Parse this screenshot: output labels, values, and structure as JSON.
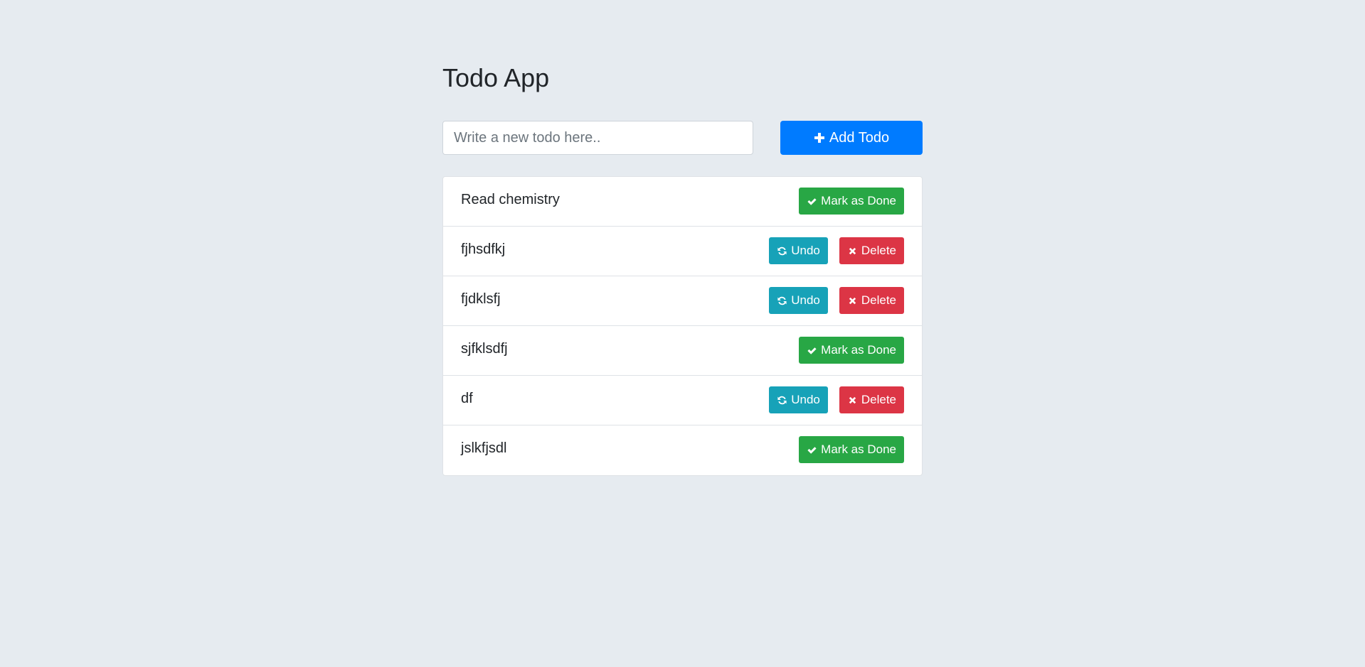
{
  "app": {
    "title": "Todo App"
  },
  "form": {
    "placeholder": "Write a new todo here..",
    "value": "",
    "add_label": "Add Todo",
    "add_icon": "plus-icon"
  },
  "buttons": {
    "done_label": "Mark as Done",
    "undo_label": "Undo",
    "delete_label": "Delete"
  },
  "colors": {
    "page_background": "#e6ebf0",
    "primary": "#007bff",
    "success": "#28a745",
    "info": "#17a2b8",
    "danger": "#dc3545"
  },
  "todos": [
    {
      "text": "Read chemistry",
      "done": false
    },
    {
      "text": "fjhsdfkj",
      "done": true
    },
    {
      "text": "fjdklsfj",
      "done": true
    },
    {
      "text": "sjfklsdfj",
      "done": false
    },
    {
      "text": "df",
      "done": true
    },
    {
      "text": "jslkfjsdl",
      "done": false
    }
  ]
}
